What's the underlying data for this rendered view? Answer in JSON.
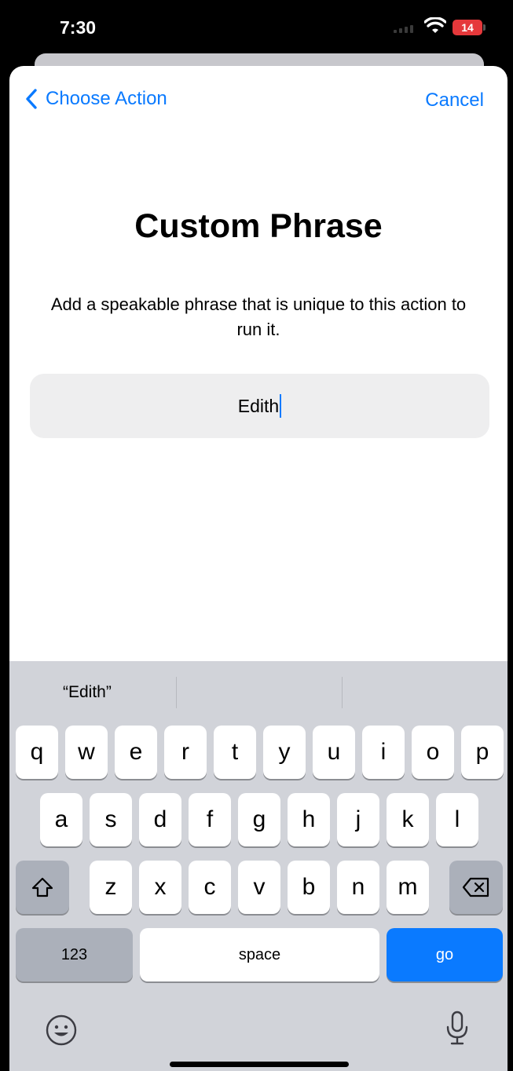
{
  "status_bar": {
    "time": "7:30",
    "battery_level": "14",
    "battery_color": "#e5383b"
  },
  "nav": {
    "back_label": "Choose Action",
    "cancel_label": "Cancel",
    "accent_color": "#0a7aff"
  },
  "page": {
    "title": "Custom Phrase",
    "subtitle": "Add a speakable phrase that is unique to this action to run it."
  },
  "phrase_field": {
    "value": "Edith"
  },
  "keyboard": {
    "suggestions": [
      "“Edith”",
      "",
      ""
    ],
    "row1": [
      "q",
      "w",
      "e",
      "r",
      "t",
      "y",
      "u",
      "i",
      "o",
      "p"
    ],
    "row2": [
      "a",
      "s",
      "d",
      "f",
      "g",
      "h",
      "j",
      "k",
      "l"
    ],
    "row3": [
      "z",
      "x",
      "c",
      "v",
      "b",
      "n",
      "m"
    ],
    "numbers_label": "123",
    "space_label": "space",
    "return_label": "go"
  }
}
